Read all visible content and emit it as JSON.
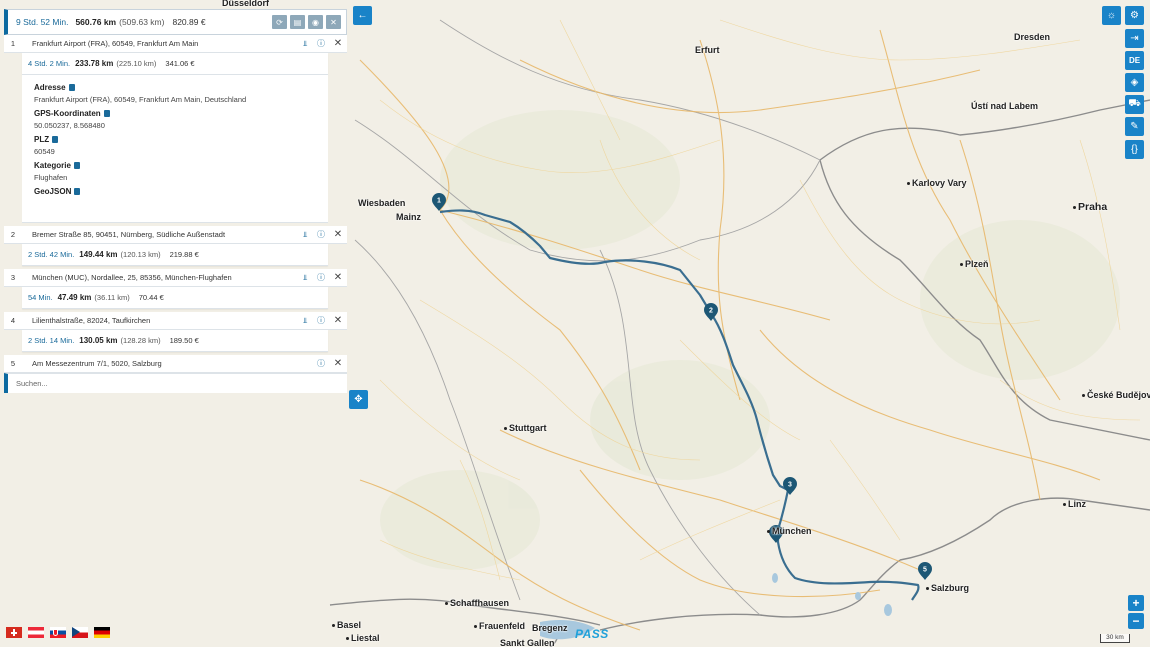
{
  "summary": {
    "time": "9 Std. 52 Min.",
    "km": "560.76 km",
    "sub": "(509.63 km)",
    "cost": "820.89 €"
  },
  "stops": [
    {
      "num": "1",
      "address": "Frankfurt Airport (FRA), 60549, Frankfurt Am Main"
    },
    {
      "num": "2",
      "address": "Bremer Straße 85, 90451, Nürnberg, Südliche Außenstadt"
    },
    {
      "num": "3",
      "address": "München (MUC), Nordallee, 25, 85356, München-Flughafen"
    },
    {
      "num": "4",
      "address": "Lilienthalstraße, 82024, Taufkirchen"
    },
    {
      "num": "5",
      "address": "Am Messezentrum 7/1, 5020, Salzburg"
    }
  ],
  "legs": [
    {
      "time": "4 Std. 2 Min.",
      "km": "233.78 km",
      "sub": "(225.10 km)",
      "cost": "341.06 €"
    },
    {
      "time": "2 Std. 42 Min.",
      "km": "149.44 km",
      "sub": "(120.13 km)",
      "cost": "219.88 €"
    },
    {
      "time": "54 Min.",
      "km": "47.49 km",
      "sub": "(36.11 km)",
      "cost": "70.44 €"
    },
    {
      "time": "2 Std. 14 Min.",
      "km": "130.05 km",
      "sub": "(128.28 km)",
      "cost": "189.50 €"
    }
  ],
  "details": {
    "adresse_label": "Adresse",
    "adresse_value": "Frankfurt Airport (FRA), 60549, Frankfurt Am Main, Deutschland",
    "gps_label": "GPS-Koordinaten",
    "gps_value": "50.050237, 8.568480",
    "plz_label": "PLZ",
    "plz_value": "60549",
    "kategorie_label": "Kategorie",
    "kategorie_value": "Flughafen",
    "geojson_label": "GeoJSON"
  },
  "search": {
    "placeholder": "Suchen..."
  },
  "controls": {
    "lang": "DE",
    "zoom_in": "+",
    "zoom_out": "−"
  },
  "scale": "30 km",
  "logo": "PASS",
  "cities": {
    "duesseldorf": "Düsseldorf",
    "erfurt": "Erfurt",
    "dresden": "Dresden",
    "usti": "Ústí nad Labem",
    "karlovy": "Karlovy Vary",
    "praha": "Praha",
    "wiesbaden": "Wiesbaden",
    "mainz": "Mainz",
    "plzen": "Plzeň",
    "stuttgart": "Stuttgart",
    "ceske": "České Budějovi",
    "linz": "Linz",
    "muenchen": "München",
    "salzburg": "Salzburg",
    "schaffhausen": "Schaffhausen",
    "basel": "Basel",
    "frauenfeld": "Frauenfeld",
    "bregenz": "Bregenz",
    "liestal": "Liestal",
    "stgallen": "Sankt Gallen"
  },
  "colors": {
    "accent": "#1983c8",
    "route": "#3a6e90",
    "marker": "#1d5775"
  }
}
